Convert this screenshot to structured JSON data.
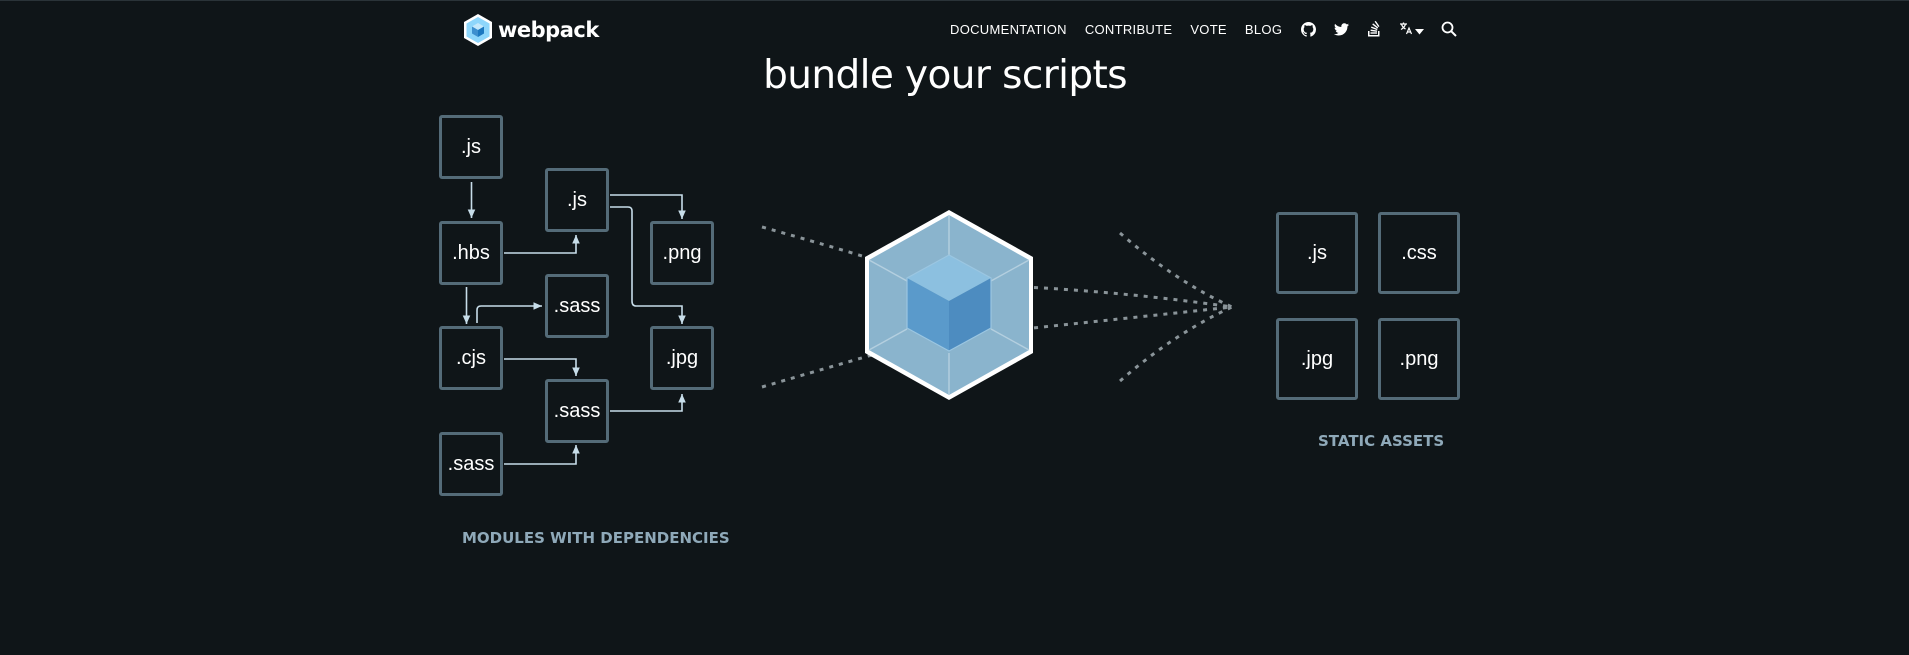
{
  "brand": {
    "name": "webpack"
  },
  "nav": {
    "links": [
      "DOCUMENTATION",
      "CONTRIBUTE",
      "VOTE",
      "BLOG"
    ],
    "icons": [
      "github-icon",
      "twitter-icon",
      "stackoverflow-icon",
      "language-icon",
      "search-icon"
    ]
  },
  "hero": {
    "title": "bundle your scripts"
  },
  "modules": {
    "caption": "MODULES WITH DEPENDENCIES",
    "files": [
      ".js",
      ".hbs",
      ".cjs",
      ".sass",
      ".js",
      ".sass",
      ".sass",
      ".png",
      ".jpg"
    ]
  },
  "assets": {
    "caption": "STATIC ASSETS",
    "files": [
      ".js",
      ".css",
      ".jpg",
      ".png"
    ]
  },
  "colors": {
    "background": "#0f1518",
    "box_border": "#546b78",
    "caption": "#8fa9b9",
    "cube_light": "#8ed6fb",
    "cube_dark": "#1c78c0"
  }
}
